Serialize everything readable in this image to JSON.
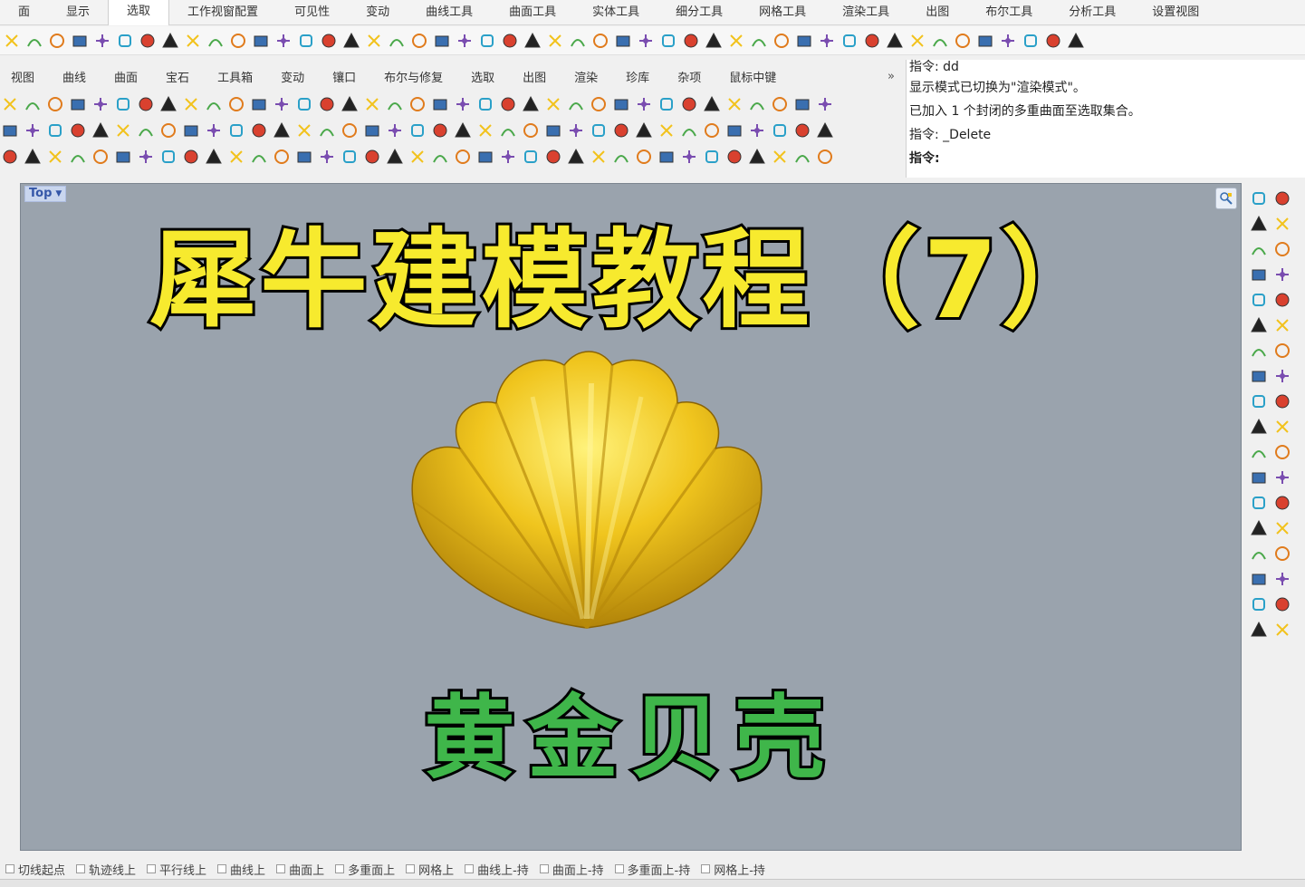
{
  "top_tabs": [
    "面",
    "显示",
    "选取",
    "工作视窗配置",
    "可见性",
    "变动",
    "曲线工具",
    "曲面工具",
    "实体工具",
    "细分工具",
    "网格工具",
    "渲染工具",
    "出图",
    "布尔工具",
    "分析工具",
    "设置视图"
  ],
  "active_top_tab": "选取",
  "secondary_tabs": [
    "视图",
    "曲线",
    "曲面",
    "宝石",
    "工具箱",
    "变动",
    "镶口",
    "布尔与修复",
    "选取",
    "出图",
    "渲染",
    "珍库",
    "杂项",
    "鼠标中键"
  ],
  "secondary_more": "»",
  "command_history": [
    "指令: dd",
    "显示模式已切换为\"渲染模式\"。",
    "已加入 1 个封闭的多重曲面至选取集合。",
    "指令: _Delete"
  ],
  "command_prompt": "指令:",
  "viewport": {
    "label": "Top",
    "title": "犀牛建模教程（7）",
    "subtitle": "黄金贝壳"
  },
  "osnap_items": [
    "切线起点",
    "轨迹线上",
    "平行线上",
    "曲线上",
    "曲面上",
    "多重面上",
    "网格上",
    "曲线上-持",
    "曲面上-持",
    "多重面上-持",
    "网格上-持"
  ],
  "colors": {
    "viewport_bg": "#9aa3ad",
    "title_fill": "#f7ea2e",
    "subtitle_fill": "#3fb64a",
    "gold": "#e0b419",
    "accent": "#3557a8"
  }
}
